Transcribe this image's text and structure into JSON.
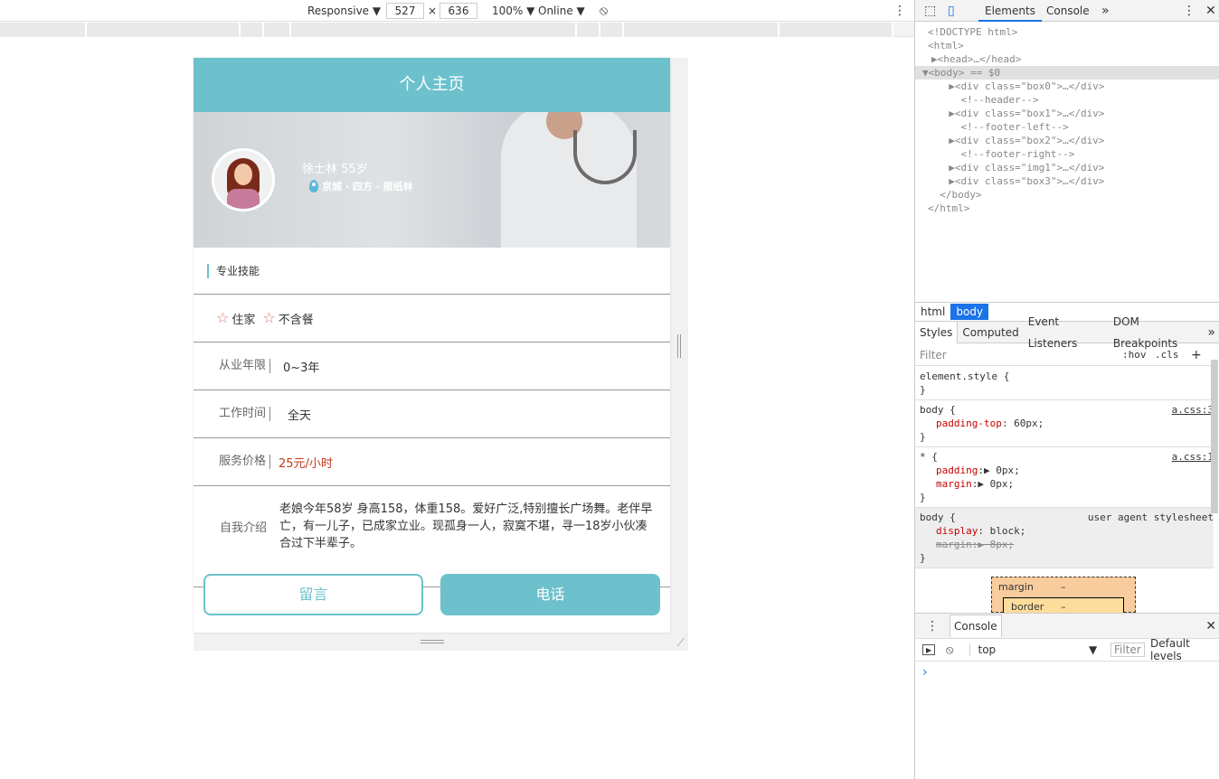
{
  "devtools_toolbar": {
    "device": "Responsive",
    "width": "527",
    "times": "×",
    "height": "636",
    "zoom": "100%",
    "network": "Online"
  },
  "page": {
    "header_title": "个人主页",
    "profile": {
      "name_age": "徐士林 55岁",
      "location": "京城 · 四方 · 报纸林"
    },
    "skills_title": "专业技能",
    "tags": [
      "住家",
      "不含餐"
    ],
    "rows": {
      "experience_label": "从业年限",
      "experience_value": "0~3年",
      "work_time_label": "工作时间",
      "work_time_value": "全天",
      "price_label": "服务价格",
      "price_value": "25元/小时"
    },
    "intro_label": "自我介绍",
    "intro_text": "老娘今年58岁 身高158，体重158。爱好广泛,特别擅长广场舞。老伴早亡，有一儿子，已成家立业。现孤身一人，寂寞不堪，寻一18岁小伙凑合过下半辈子。",
    "buttons": {
      "message": "留言",
      "call": "电话"
    }
  },
  "devtools": {
    "tabs": [
      "Elements",
      "Console"
    ],
    "more": "»",
    "dom_lines": [
      "<!DOCTYPE html>",
      "<html>",
      "▶<head>…</head>",
      "▼<body> == $0",
      "  ▶<div class=\"box0\">…</div>",
      "    <!--header-->",
      "  ▶<div class=\"box1\">…</div>",
      "    <!--footer-left-->",
      "  ▶<div class=\"box2\">…</div>",
      "    <!--footer-right-->",
      "  ▶<div class=\"img1\">…</div>",
      "  ▶<div class=\"box3\">…</div>",
      "  </body>",
      "</html>"
    ],
    "breadcrumb": [
      "html",
      "body"
    ],
    "styles_tabs": [
      "Styles",
      "Computed",
      "Event Listeners",
      "DOM Breakpoints"
    ],
    "filter_placeholder": "Filter",
    "hov": ":hov",
    "cls": ".cls",
    "plus": "+",
    "rules": [
      {
        "selector": "element.style {",
        "close": "}"
      },
      {
        "selector": "body {",
        "src": "a.css:3",
        "props": [
          [
            "padding-top",
            "60px;"
          ]
        ],
        "close": "}"
      },
      {
        "selector": "* {",
        "src": "a.css:1",
        "props": [
          [
            "padding",
            "▶ 0px;"
          ],
          [
            "margin",
            "▶ 0px;"
          ]
        ],
        "close": "}"
      },
      {
        "selector": "body {",
        "ua": "user agent stylesheet",
        "props": [
          [
            "display",
            "block;"
          ],
          [
            "margin",
            "▶ 8px;"
          ]
        ],
        "close": "}"
      }
    ],
    "box_model": {
      "margin": "margin",
      "border": "border",
      "dash": "–"
    },
    "console": {
      "tab": "Console",
      "context": "top",
      "filter": "Filter",
      "levels": "Default levels",
      "prompt": "›"
    }
  },
  "colors": {
    "accent": "#6cc1cc",
    "price": "#c0391b",
    "devtools_blue": "#1a73e8"
  }
}
